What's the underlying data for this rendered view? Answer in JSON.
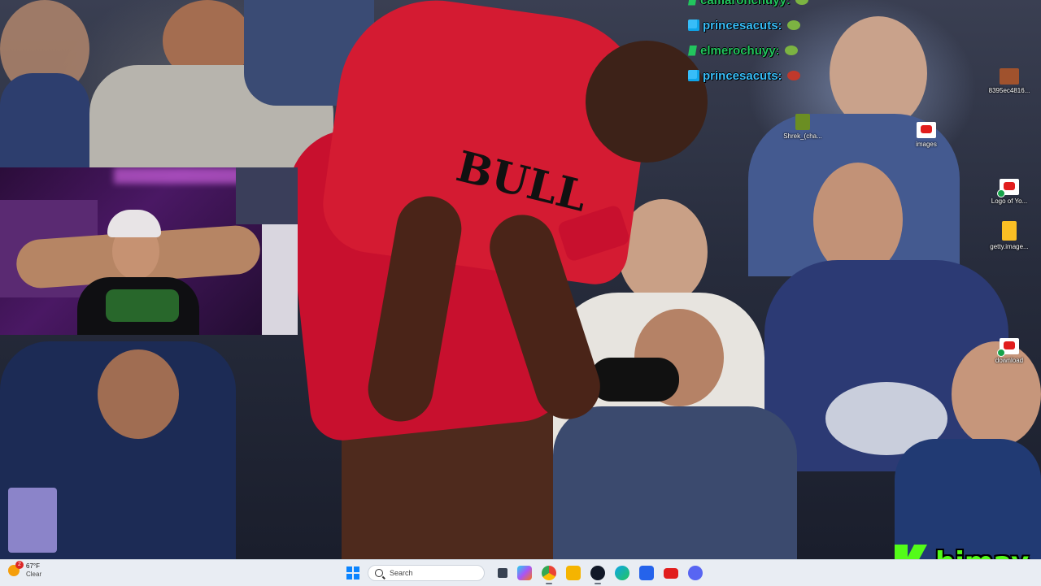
{
  "chat": {
    "messages": [
      {
        "user": "camaronchuyy:",
        "color": "#22c55e",
        "badge": "green-badge",
        "emote": "frog-emote"
      },
      {
        "user": "princesacuts:",
        "color": "#38bdf8",
        "badge": "blue-diamond-badge",
        "emote": "frog-emote"
      },
      {
        "user": "elmerochuyy:",
        "color": "#22c55e",
        "badge": "green-badge",
        "emote": "frog-emote"
      },
      {
        "user": "princesacuts:",
        "color": "#38bdf8",
        "badge": "blue-diamond-badge",
        "emote": "dog-emote"
      }
    ]
  },
  "desktop": {
    "icons": [
      {
        "label": "8395ec4816...",
        "icon": "image-file-icon"
      },
      {
        "label": "Shrek_(cha...",
        "icon": "shrek-image-icon"
      },
      {
        "label": "images",
        "icon": "youtube-icon"
      },
      {
        "label": "Logo of Yo...",
        "icon": "youtube-icon"
      },
      {
        "label": "getty.image...",
        "icon": "image-file-icon"
      },
      {
        "label": "download",
        "icon": "youtube-icon"
      }
    ]
  },
  "watermark": {
    "text": "himay",
    "accent": "#53fc18"
  },
  "taskbar": {
    "weather": {
      "temp": "67°F",
      "condition": "Clear",
      "notification_count": "2"
    },
    "search_placeholder": "Search",
    "apps": [
      {
        "name": "task-view",
        "color": "#374151"
      },
      {
        "name": "copilot",
        "color": "#a855f7"
      },
      {
        "name": "chrome",
        "color": "#ea4335"
      },
      {
        "name": "file-explorer",
        "color": "#f5b400"
      },
      {
        "name": "obs",
        "color": "#111827"
      },
      {
        "name": "edge",
        "color": "#0ea5e9"
      },
      {
        "name": "microsoft-store",
        "color": "#2563eb"
      },
      {
        "name": "youtube",
        "color": "#e11d1d"
      },
      {
        "name": "discord",
        "color": "#5865f2"
      }
    ]
  }
}
